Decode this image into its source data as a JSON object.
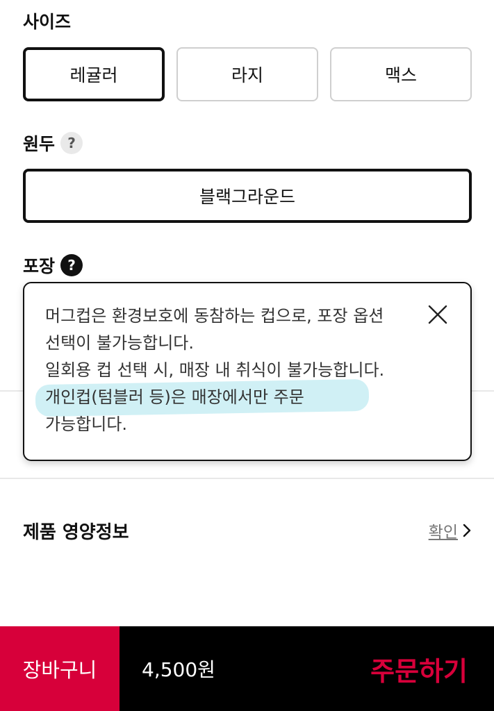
{
  "size": {
    "title": "사이즈",
    "options": [
      {
        "label": "레귤러",
        "selected": true
      },
      {
        "label": "라지",
        "selected": false
      },
      {
        "label": "맥스",
        "selected": false
      }
    ]
  },
  "bean": {
    "title": "원두",
    "help": "?",
    "selected": "블랙그라운드"
  },
  "packaging": {
    "title": "포장",
    "help": "?"
  },
  "tooltip": {
    "lines": [
      "머그컵은 환경보호에 동참하는 컵으로, 포장 옵션",
      "선택이 불가능합니다.",
      "일회용 컵 선택 시, 매장 내 취식이 불가능합니다.",
      "개인컵(텀블러 등)은 매장에서만 주문",
      "가능합니다."
    ]
  },
  "nutrition": {
    "title": "제품 영양정보",
    "link": "확인"
  },
  "bottom": {
    "cart": "장바구니",
    "price": "4,500원",
    "order": "주문하기"
  },
  "colors": {
    "accent": "#d7003a",
    "highlight": "#aae4ec"
  }
}
